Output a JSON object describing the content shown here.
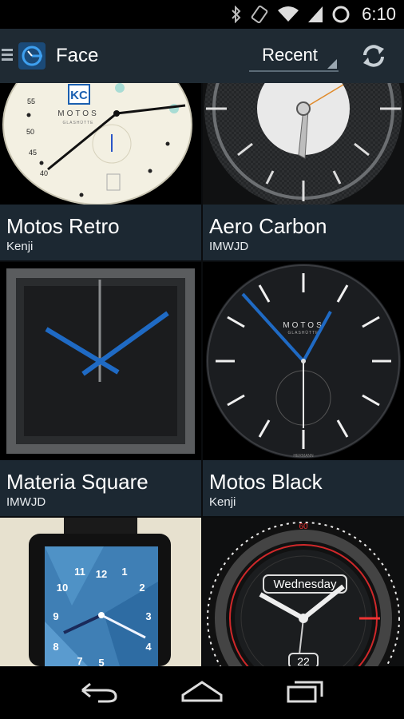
{
  "status_bar": {
    "time": "6:10",
    "icons": [
      "bluetooth-icon",
      "vibrate-icon",
      "wifi-icon",
      "signal-icon",
      "sync-circle-icon"
    ]
  },
  "action_bar": {
    "title": "Face",
    "sort_spinner": {
      "selected": "Recent"
    },
    "icons": [
      "menu-up-icon",
      "app-logo-icon",
      "refresh-icon"
    ]
  },
  "faces": [
    {
      "name": "Motos Retro",
      "author": "Kenji",
      "dial_brand": "MOTOS",
      "dial_sub": "GLASHÜTTE",
      "badge": "KC",
      "dial_numbers": [
        "55",
        "50",
        "45",
        "40"
      ]
    },
    {
      "name": "Aero Carbon",
      "author": "IMWJD"
    },
    {
      "name": "Materia Square",
      "author": "IMWJD"
    },
    {
      "name": "Motos Black",
      "author": "Kenji",
      "dial_brand": "MOTOS",
      "dial_sub": "GLASHÜTTE",
      "dial_foot": "HERMANN"
    },
    {
      "name": "",
      "author": "",
      "dial_numbers": [
        "11",
        "12",
        "1",
        "10",
        "2",
        "9",
        "3",
        "8",
        "4",
        "7",
        "5"
      ]
    },
    {
      "name": "",
      "author": "",
      "day_label": "Wednesday",
      "date_label": "22",
      "ring_top": "60"
    }
  ],
  "colors": {
    "action_bar": "#1f2a33",
    "caption_bg": "#1c2832",
    "accent_blue": "#2a7fd4"
  }
}
